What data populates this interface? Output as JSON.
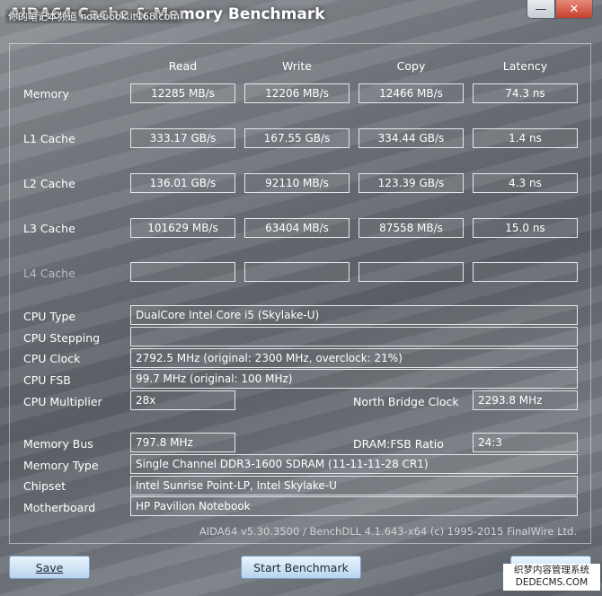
{
  "window": {
    "title": "AIDA64 Cache & Memory Benchmark",
    "watermark": "你的笔记本频道 notebook.it168.com",
    "btn_minimize": "—",
    "btn_close": "✕"
  },
  "columns": [
    "Read",
    "Write",
    "Copy",
    "Latency"
  ],
  "rows": [
    {
      "label": "Memory",
      "values": [
        "12285 MB/s",
        "12206 MB/s",
        "12466 MB/s",
        "74.3 ns"
      ]
    },
    {
      "label": "L1 Cache",
      "values": [
        "333.17 GB/s",
        "167.55 GB/s",
        "334.44 GB/s",
        "1.4 ns"
      ]
    },
    {
      "label": "L2 Cache",
      "values": [
        "136.01 GB/s",
        "92110 MB/s",
        "123.39 GB/s",
        "4.3 ns"
      ]
    },
    {
      "label": "L3 Cache",
      "values": [
        "101629 MB/s",
        "63404 MB/s",
        "87558 MB/s",
        "15.0 ns"
      ]
    },
    {
      "label": "L4 Cache",
      "values": [
        "",
        "",
        "",
        ""
      ]
    }
  ],
  "info": {
    "cpu_type_label": "CPU Type",
    "cpu_type": "DualCore Intel Core i5  (Skylake-U)",
    "cpu_stepping_label": "CPU Stepping",
    "cpu_stepping": "",
    "cpu_clock_label": "CPU Clock",
    "cpu_clock": "2792.5 MHz  (original: 2300 MHz, overclock: 21%)",
    "cpu_fsb_label": "CPU FSB",
    "cpu_fsb": "99.7 MHz  (original: 100 MHz)",
    "cpu_multiplier_label": "CPU Multiplier",
    "cpu_multiplier": "28x",
    "nb_clock_label": "North Bridge Clock",
    "nb_clock": "2293.8 MHz",
    "memory_bus_label": "Memory Bus",
    "memory_bus": "797.8 MHz",
    "dram_ratio_label": "DRAM:FSB Ratio",
    "dram_ratio": "24:3",
    "memory_type_label": "Memory Type",
    "memory_type": "Single Channel DDR3-1600 SDRAM  (11-11-11-28 CR1)",
    "chipset_label": "Chipset",
    "chipset": "Intel Sunrise Point-LP, Intel Skylake-U",
    "motherboard_label": "Motherboard",
    "motherboard": "HP Pavilion Notebook"
  },
  "footer": "AIDA64 v5.30.3500 / BenchDLL 4.1.643-x64  (c) 1995-2015 FinalWire Ltd.",
  "buttons": {
    "save": "Save",
    "start": "Start Benchmark"
  },
  "watermark2": {
    "line1": "织梦内容管理系统",
    "line2": "DEDECMS.COM"
  }
}
